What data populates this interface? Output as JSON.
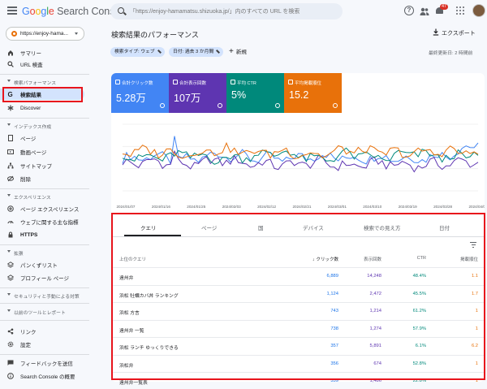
{
  "app": {
    "logo_google": "Google",
    "logo_product": " Search Console"
  },
  "search": {
    "placeholder": "「https://enjoy-hamamatsu.shizuoka.jp/」内のすべての URL を検索"
  },
  "header": {
    "help_icon": "?",
    "notifications_badge": "47"
  },
  "property": {
    "label": "https://enjoy-hama..."
  },
  "sidebar": {
    "items_top": [
      {
        "label": "サマリー"
      },
      {
        "label": "URL 検査"
      }
    ],
    "section_performance": "検索パフォーマンス",
    "items_performance": [
      {
        "label": "検索結果"
      },
      {
        "label": "Discover"
      }
    ],
    "section_index": "インデックス作成",
    "items_index": [
      {
        "label": "ページ"
      },
      {
        "label": "動画ページ"
      },
      {
        "label": "サイトマップ"
      },
      {
        "label": "削除"
      }
    ],
    "section_experience": "エクスペリエンス",
    "items_experience": [
      {
        "label": "ページ エクスペリエンス"
      },
      {
        "label": "ウェブに関する主な指標"
      },
      {
        "label": "HTTPS"
      }
    ],
    "section_enhancements": "拡張",
    "items_enhancements": [
      {
        "label": "パンくずリスト"
      },
      {
        "label": "プロフィール ページ"
      }
    ],
    "section_security": "セキュリティと手動による対策",
    "section_legacy": "以前のツールとレポート",
    "items_bottom": [
      {
        "label": "リンク"
      },
      {
        "label": "設定"
      }
    ],
    "items_footer": [
      {
        "label": "フィードバックを送信"
      },
      {
        "label": "Search Console の概要"
      }
    ]
  },
  "main": {
    "title": "検索結果のパフォーマンス",
    "export_label": "エクスポート",
    "chips": [
      {
        "label": "検索タイプ: ウェブ"
      },
      {
        "label": "日付: 過去 3 か月間"
      }
    ],
    "new_label": "新規",
    "updated": "最終更新日: 2 時間前"
  },
  "metrics": [
    {
      "label": "合計クリック数",
      "value": "5.28万",
      "color": "#4285f4"
    },
    {
      "label": "合計表示回数",
      "value": "107万",
      "color": "#5e35b1"
    },
    {
      "label": "平均 CTR",
      "value": "5%",
      "color": "#00897b"
    },
    {
      "label": "平均掲載順位",
      "value": "15.2",
      "color": "#e8710a"
    }
  ],
  "chart_data": {
    "type": "line",
    "x": [
      "2024/01/07",
      "2024/01/16",
      "2024/01/25",
      "2024/02/03",
      "2024/02/12",
      "2024/02/21",
      "2024/03/01",
      "2024/03/10",
      "2024/03/19",
      "2024/03/28",
      "2024/04/06"
    ],
    "series": [
      {
        "name": "合計クリック数",
        "color": "#4285f4",
        "values": [
          48,
          52,
          46,
          55,
          50,
          47,
          53,
          49,
          51,
          48,
          54,
          70
        ]
      },
      {
        "name": "合計表示回数",
        "color": "#5e35b1",
        "values": [
          40,
          44,
          38,
          46,
          41,
          39,
          43,
          37,
          42,
          38,
          41,
          44
        ]
      },
      {
        "name": "平均 CTR",
        "color": "#00897b",
        "values": [
          52,
          49,
          55,
          47,
          53,
          58,
          46,
          56,
          48,
          57,
          50,
          54
        ]
      },
      {
        "name": "平均掲載順位",
        "color": "#e8710a",
        "values": [
          58,
          60,
          55,
          62,
          57,
          59,
          54,
          61,
          58,
          56,
          60,
          57
        ]
      }
    ]
  },
  "table": {
    "tabs": [
      "クエリ",
      "ページ",
      "国",
      "デバイス",
      "検索での見え方",
      "日付"
    ],
    "headers": {
      "query": "上位のクエリ",
      "clicks": "クリック数",
      "impressions": "表示回数",
      "ctr": "CTR",
      "position": "掲載順位"
    },
    "rows": [
      {
        "query": "遠州弁",
        "clicks": "6,889",
        "impressions": "14,248",
        "ctr": "48.4%",
        "position": "1.1"
      },
      {
        "query": "浜松 牡蠣カバ丼 ランキング",
        "clicks": "1,124",
        "impressions": "2,472",
        "ctr": "45.5%",
        "position": "1.7"
      },
      {
        "query": "浜松 方言",
        "clicks": "743",
        "impressions": "1,214",
        "ctr": "61.2%",
        "position": "1"
      },
      {
        "query": "遠州弁 一覧",
        "clicks": "738",
        "impressions": "1,274",
        "ctr": "57.9%",
        "position": "1"
      },
      {
        "query": "浜松 ランチ ゆっくりできる",
        "clicks": "357",
        "impressions": "5,891",
        "ctr": "6.1%",
        "position": "6.2"
      },
      {
        "query": "浜松弁",
        "clicks": "356",
        "impressions": "674",
        "ctr": "52.8%",
        "position": "1"
      },
      {
        "query": "遠州弁一覧表",
        "clicks": "339",
        "impressions": "1,486",
        "ctr": "22.8%",
        "position": "1"
      }
    ]
  }
}
